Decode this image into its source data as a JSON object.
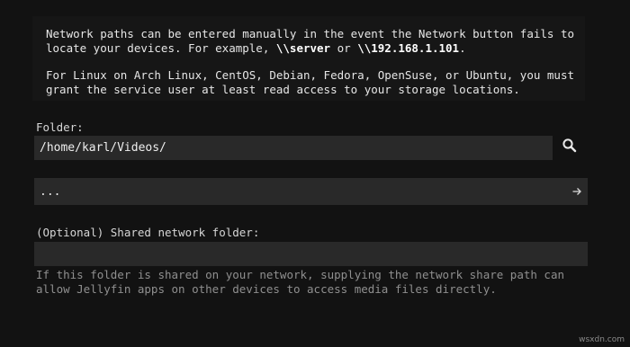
{
  "info": {
    "line1": "Network paths can be entered manually in the event the Network button fails to",
    "line2_pre": "locate your devices. For example, ",
    "line2_server": "\\\\server",
    "line2_mid": " or ",
    "line2_ip": "\\\\192.168.1.101",
    "line2_post": ".",
    "line3": "For Linux on Arch Linux, CentOS, Debian, Fedora, OpenSuse, or Ubuntu, you must",
    "line4": "grant the service user at least read access to your storage locations."
  },
  "folder": {
    "label": "Folder:",
    "value": "/home/karl/Videos/",
    "search_icon": "search-icon"
  },
  "path_row": {
    "text": "...",
    "arrow_icon": "arrow-right-icon"
  },
  "shared": {
    "label": "(Optional) Shared network folder:",
    "value": "",
    "help_line1": "If this folder is shared on your network, supplying the network share path can",
    "help_line2": "allow Jellyfin apps on other devices to access media files directly."
  },
  "watermark": "wsxdn.com",
  "colors": {
    "background": "#121212",
    "field": "#292929",
    "help_text": "#8f8f8f"
  }
}
